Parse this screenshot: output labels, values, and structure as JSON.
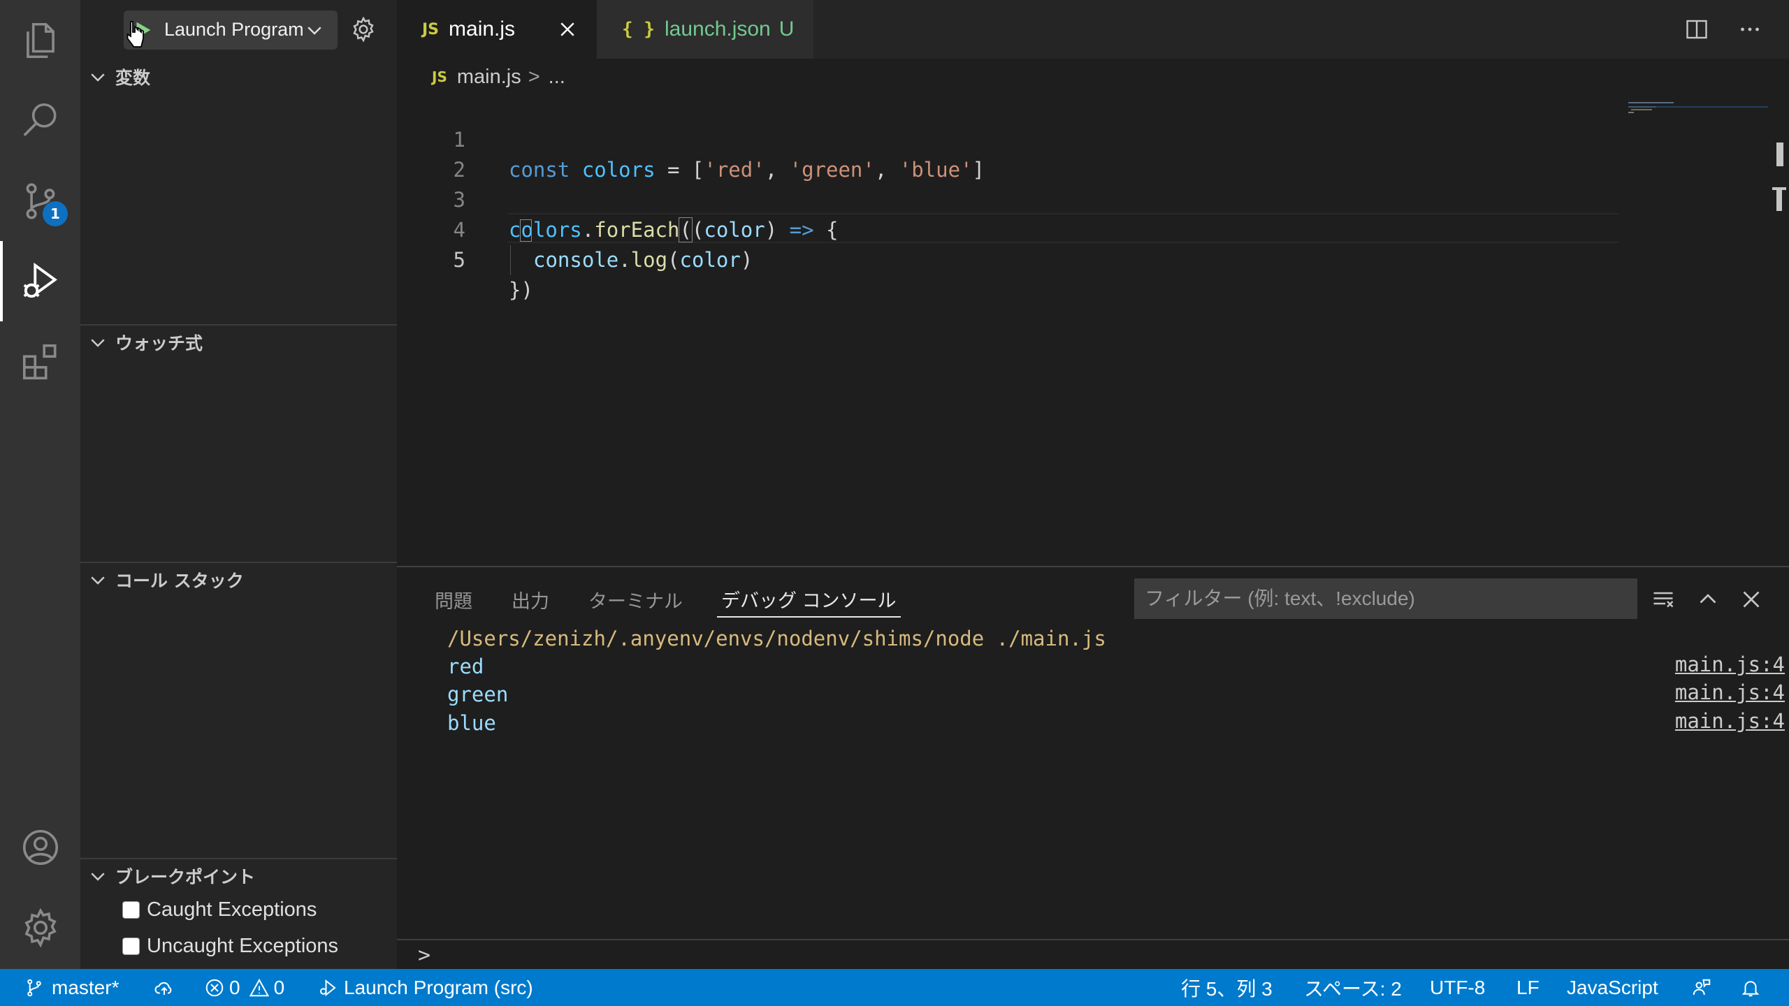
{
  "activity_bar": {
    "items": [
      {
        "name": "explorer-icon"
      },
      {
        "name": "search-icon"
      },
      {
        "name": "source-control-icon",
        "badge": "1"
      },
      {
        "name": "run-debug-icon",
        "active": true
      },
      {
        "name": "extensions-icon"
      }
    ],
    "bottom": [
      {
        "name": "account-icon"
      },
      {
        "name": "manage-gear-icon"
      }
    ]
  },
  "debug_toolbar": {
    "launch_config": "Launch Program"
  },
  "sidebar": {
    "sections": {
      "variables": "変数",
      "watch": "ウォッチ式",
      "call_stack": "コール スタック",
      "breakpoints": "ブレークポイント"
    },
    "breakpoints": [
      {
        "label": "Caught Exceptions",
        "checked": false
      },
      {
        "label": "Uncaught Exceptions",
        "checked": false
      }
    ]
  },
  "tabs": [
    {
      "icon": "JS",
      "label": "main.js",
      "active": true
    },
    {
      "icon": "{ }",
      "label": "launch.json",
      "status": "U",
      "active": false
    }
  ],
  "breadcrumb": {
    "icon": "JS",
    "file": "main.js",
    "separator": ">",
    "rest": "..."
  },
  "editor": {
    "line_numbers": [
      "1",
      "2",
      "3",
      "4",
      "5"
    ],
    "current_line": 5,
    "code": {
      "l1": {
        "kw": "const",
        "var": "colors",
        "eq": " = [",
        "s1": "'red'",
        "c1": ", ",
        "s2": "'green'",
        "c2": ", ",
        "s3": "'blue'",
        "end": "]"
      },
      "l3": {
        "var": "colors",
        "dot": ".",
        "fn": "forEach",
        "open": "(",
        "p1": "(",
        "par": "color",
        "p2": ")",
        "arrow": " => ",
        "brace": "{"
      },
      "l4": {
        "obj": "console",
        "dot": ".",
        "fn": "log",
        "open": "(",
        "par": "color",
        "close": ")"
      },
      "l5": {
        "text": "})"
      }
    }
  },
  "panel": {
    "tabs": [
      "問題",
      "出力",
      "ターミナル",
      "デバッグ コンソール"
    ],
    "active_tab": "デバッグ コンソール",
    "filter_placeholder": "フィルター (例: text、!exclude)",
    "output": [
      {
        "text": "/Users/zenizh/.anyenv/envs/nodenv/shims/node ./main.js",
        "color": "#d7ba7d",
        "link": ""
      },
      {
        "text": "red",
        "color": "#9cdcfe",
        "link": "main.js:4"
      },
      {
        "text": "green",
        "color": "#9cdcfe",
        "link": "main.js:4"
      },
      {
        "text": "blue",
        "color": "#9cdcfe",
        "link": "main.js:4"
      }
    ],
    "repl_prompt": ">"
  },
  "status_bar": {
    "branch": "master*",
    "errors": "0",
    "warnings": "0",
    "debug_target": "Launch Program (src)",
    "position": "行 5、列 3",
    "spaces": "スペース: 2",
    "encoding": "UTF-8",
    "eol": "LF",
    "language": "JavaScript"
  },
  "colors": {
    "accent": "#007acc",
    "activity_bar": "#333333",
    "sidebar": "#252526",
    "editor": "#1e1e1e",
    "badge": "#0e70c0",
    "untracked": "#73c991"
  }
}
